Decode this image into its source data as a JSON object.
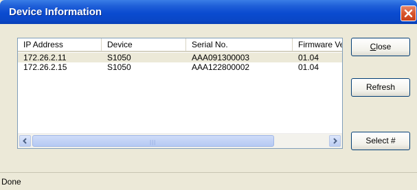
{
  "window": {
    "title": "Device Information"
  },
  "list": {
    "columns": [
      "IP Address",
      "Device",
      "Serial No.",
      "Firmware Ver."
    ],
    "rows": [
      {
        "ip": "172.26.2.11",
        "device": "S1050",
        "serial": "AAA091300003",
        "firmware": "01.04"
      },
      {
        "ip": "172.26.2.15",
        "device": "S1050",
        "serial": "AAA122800002",
        "firmware": "01.04"
      }
    ]
  },
  "buttons": {
    "close_first": "C",
    "close_rest": "lose",
    "refresh": "Refresh",
    "select": "Select #"
  },
  "status": {
    "text": "Done"
  },
  "colors": {
    "title_bar": "#0a4bd0",
    "close_button": "#d8562e",
    "dialog_bg": "#ece9d8"
  },
  "icons": {
    "window_close": "close-x-icon",
    "scroll_left": "chevron-left-icon",
    "scroll_right": "chevron-right-icon"
  }
}
